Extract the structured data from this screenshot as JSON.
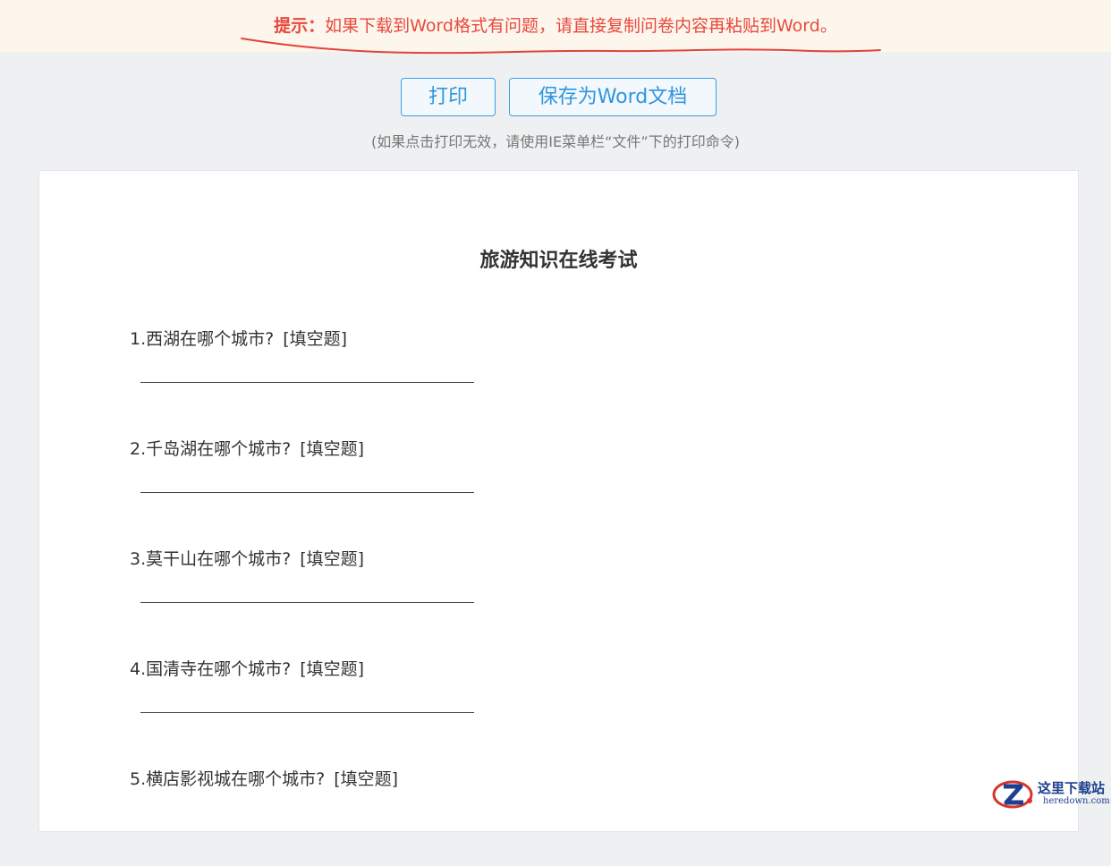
{
  "notice": {
    "label": "提示：",
    "text": "如果下载到Word格式有问题，请直接复制问卷内容再粘贴到Word。",
    "color": "#e8493e"
  },
  "toolbar": {
    "print_label": "打印",
    "save_word_label": "保存为Word文档",
    "hint": "(如果点击打印无效，请使用IE菜单栏“文件”下的打印命令)",
    "accent": "#2f95df"
  },
  "survey": {
    "title": "旅游知识在线考试",
    "questions": [
      {
        "text": "1.西湖在哪个城市?",
        "tag": "[填空题]"
      },
      {
        "text": "2.千岛湖在哪个城市?",
        "tag": "[填空题]"
      },
      {
        "text": "3.莫干山在哪个城市?",
        "tag": "[填空题]"
      },
      {
        "text": "4.国清寺在哪个城市?",
        "tag": "[填空题]"
      },
      {
        "text": "5.横店影视城在哪个城市?",
        "tag": "[填空题]"
      }
    ]
  },
  "watermark": {
    "cn": "这里下载站",
    "en": "heredown.com",
    "icon": "heredown-logo-icon"
  }
}
